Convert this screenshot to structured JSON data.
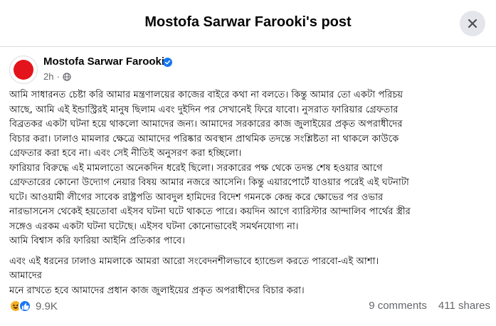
{
  "dialog": {
    "title": "Mostofa Sarwar Farooki's post"
  },
  "post": {
    "author": "Mostofa Sarwar Farooki",
    "timestamp": "2h",
    "lines": [
      "আমি সাধারনত চেষ্টা করি আমার মন্ত্রণালয়ের কাজের বাইরে কথা না বলতে। কিন্তু আমার তো একটা পরিচয়",
      "আছে, আমি এই ইন্ডাস্ট্রিরই মানুষ ছিলাম এবং দুইদিন পর সেখানেই ফিরে যাবো। নুসরাত ফারিয়ার গ্রেফতার",
      "বিব্রতকর একটা ঘটনা হয়ে থাকলো আমাদের জন্য। আমাদের সরকারের কাজ জুলাইয়ের প্রকৃত অপরাধীদের",
      "বিচার করা। ঢালাও মামলার ক্ষেত্রে আমাদের পরিষ্কার অবস্থান প্রাথমিক তদন্তে সংশ্লিষ্টতা না থাকলে কাউকে",
      "গ্রেফতার করা হবে না। এবং সেই নীতিই অনুসরণ করা হচ্ছিলো।",
      "ফারিয়ার বিরুদ্ধে এই মামলাতো অনেকদিন ধরেই ছিলো। সরকারের পক্ষ থেকে তদন্ত শেষ হওয়ার আগে",
      "গ্রেফতারের কোনো উদ্যোগ নেয়ার বিষয় আমার নজরে আসেনি। কিন্তু এয়ারপোর্টে যাওয়ার পরেই এই ঘটনাটা",
      "ঘটে। আওয়ামী লীগের সাবেক রাষ্ট্রপতি আবদুল হামিদের বিদেশ গমনকে কেন্দ্র করে ক্ষোভের পর ওভার",
      "নারভাসনেস থেকেই হয়তোবা এইসব ঘটনা ঘটে থাকতে পারে। কয়দিন আগে ব্যারিস্টার আন্দালিব পার্থের স্ত্রীর",
      "সঙ্গেও এরকম একটা ঘটনা ঘটেছে। এইসব ঘটনা কোনোভাবেই সমর্থনযোগ্য না।",
      "আমি বিশ্বাস করি ফারিয়া আইনি প্রতিকার পাবে।"
    ],
    "lines2": [
      "এবং এই ধরনের ঢালাও মামলাকে আমরা আরো সংবেদনশীলভাবে হ্যান্ডেল করতে পারবো-এই আশা।",
      "আমাদের",
      "মনে রাখতে হবে আমাদের প্রধান কাজ জুলাইয়ের প্রকৃত অপরাধীদের বিচার করা।"
    ]
  },
  "footer": {
    "reaction_icons": [
      "haha-icon",
      "like-icon"
    ],
    "reaction_count": "9.9K",
    "comments": "9 comments",
    "shares": "411 shares"
  },
  "colors": {
    "verified": "#1877f2",
    "avatar": "#e3141b",
    "like": "#1877f2",
    "haha": "#f7b125"
  }
}
